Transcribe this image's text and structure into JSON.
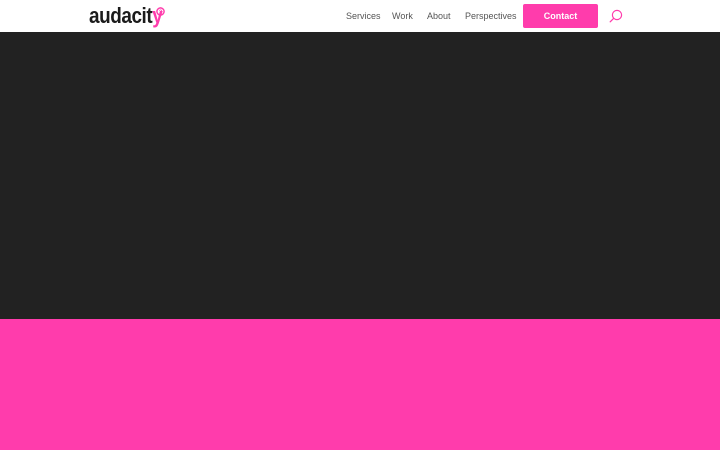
{
  "brand": {
    "name_main": "audacit",
    "name_accent": "y",
    "accent_color": "#ff3cac"
  },
  "nav": {
    "items": [
      {
        "label": "Services"
      },
      {
        "label": "Work"
      },
      {
        "label": "About"
      },
      {
        "label": "Perspectives"
      }
    ],
    "contact_label": "Contact",
    "search_icon": "search-icon"
  },
  "colors": {
    "hero_background": "#222222",
    "band_background": "#ff3cac",
    "header_background": "#ffffff",
    "nav_text": "#555555"
  }
}
